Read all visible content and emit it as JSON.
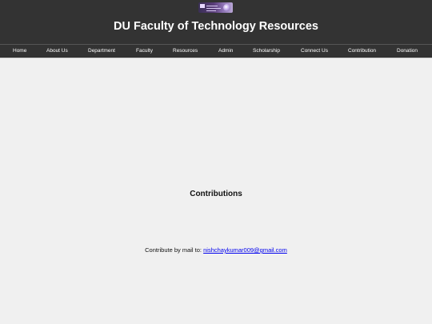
{
  "header": {
    "title": "DU Faculty of Technology Resources",
    "logo_icon": "du-fot-logo-icon"
  },
  "nav": {
    "items": [
      {
        "label": "Home"
      },
      {
        "label": "About Us"
      },
      {
        "label": "Department"
      },
      {
        "label": "Faculty"
      },
      {
        "label": "Resources"
      },
      {
        "label": "Admin"
      },
      {
        "label": "Scholarship"
      },
      {
        "label": "Connect Us"
      },
      {
        "label": "Contribution"
      },
      {
        "label": "Donation"
      }
    ]
  },
  "main": {
    "heading": "Contributions",
    "contribute_text": "Contribute by mail to:",
    "email": "nishchaykumar009@gmail.com"
  },
  "colors": {
    "header_bg": "#333333",
    "page_bg": "#f0f0f0",
    "link": "#0000ee"
  }
}
